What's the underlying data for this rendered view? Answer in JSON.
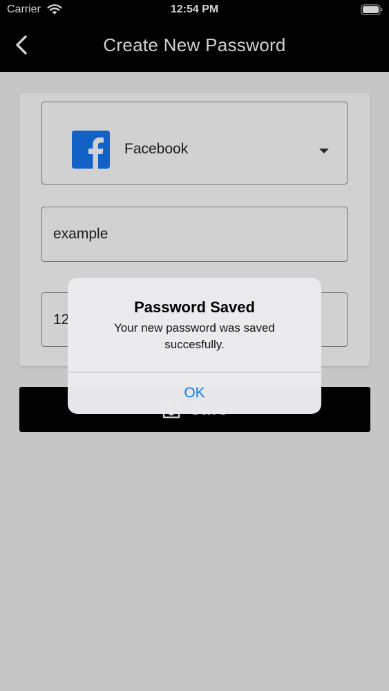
{
  "status_bar": {
    "carrier": "Carrier",
    "time": "12:54 PM"
  },
  "header": {
    "title": "Create New Password",
    "back_icon": "chevron-left-icon"
  },
  "form": {
    "site": {
      "label": "Facebook",
      "icon": "facebook-icon",
      "icon_color": "#1877f2"
    },
    "username": {
      "value": "example"
    },
    "password": {
      "value": "12"
    }
  },
  "save_button": {
    "label": "Save",
    "icon": "save-icon"
  },
  "alert": {
    "title": "Password Saved",
    "message": "Your new password was saved succesfully.",
    "ok_label": "OK",
    "ok_color": "#0a7aff"
  }
}
